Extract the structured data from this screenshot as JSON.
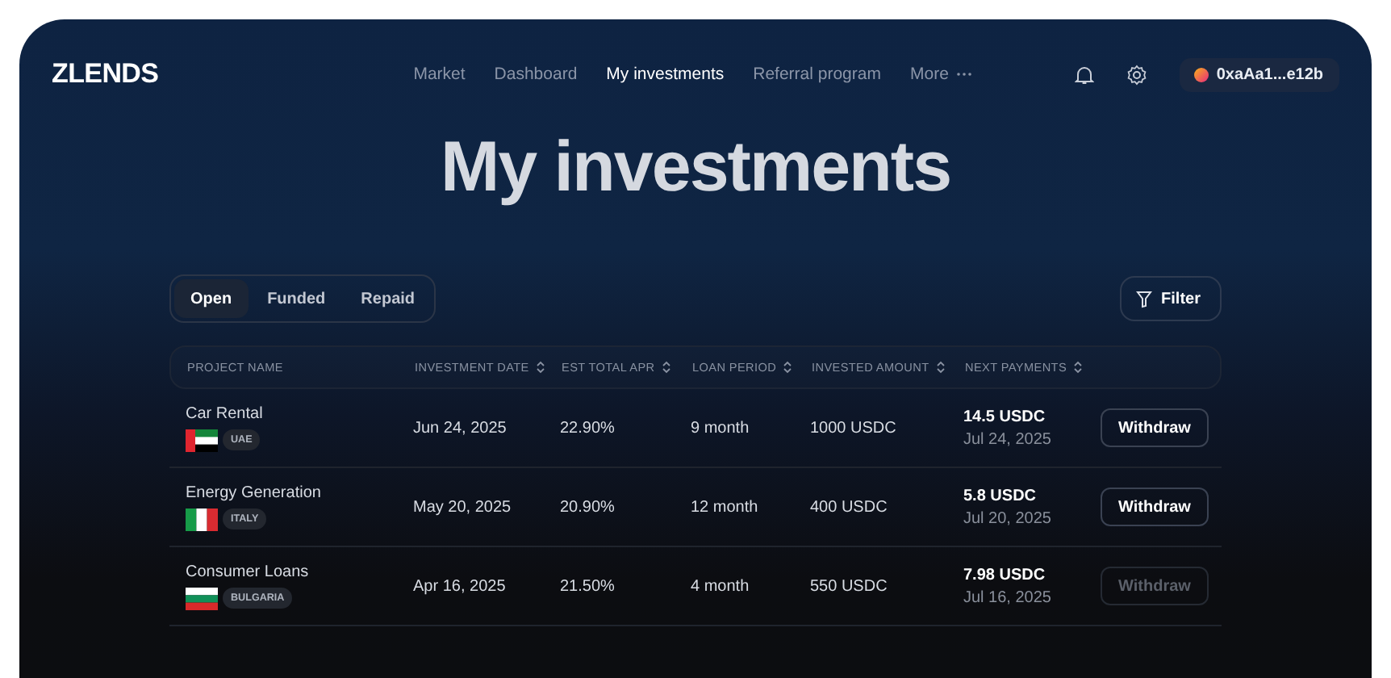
{
  "brand": {
    "logo": "ZLENDS"
  },
  "nav": {
    "links": [
      {
        "label": "Market",
        "selected": false
      },
      {
        "label": "Dashboard",
        "selected": false
      },
      {
        "label": "My investments",
        "selected": true
      },
      {
        "label": "Referral program",
        "selected": false
      },
      {
        "label": "More",
        "selected": false,
        "kind": "more"
      }
    ],
    "wallet": "0xaAa1...e12b"
  },
  "page_title": "My investments",
  "tabs": [
    {
      "label": "Open",
      "selected": true
    },
    {
      "label": "Funded",
      "selected": false
    },
    {
      "label": "Repaid",
      "selected": false
    }
  ],
  "filter_button": "Filter",
  "table": {
    "columns": [
      {
        "label": "PROJECT NAME",
        "sortable": false
      },
      {
        "label": "INVESTMENT DATE",
        "sortable": true
      },
      {
        "label": "EST TOTAL APR",
        "sortable": true
      },
      {
        "label": "LOAN PERIOD",
        "sortable": true
      },
      {
        "label": "INVESTED AMOUNT",
        "sortable": true
      },
      {
        "label": "NEXT PAYMENTS",
        "sortable": true
      }
    ],
    "rows": [
      {
        "project": "Car Rental",
        "kind": "uae",
        "country": "UAE",
        "date": "Jun 24, 2025",
        "apr": "22.90%",
        "period": "9 month",
        "amount": "1000 USDC",
        "next_amount": "14.5 USDC",
        "next_date": "Jul 24, 2025",
        "action": "Withdraw",
        "disabled": false
      },
      {
        "project": "Energy Generation",
        "kind": "italy",
        "country": "ITALY",
        "date": "May 20, 2025",
        "apr": "20.90%",
        "period": "12 month",
        "amount": "400 USDC",
        "next_amount": "5.8 USDC",
        "next_date": "Jul 20, 2025",
        "action": "Withdraw",
        "disabled": false
      },
      {
        "project": "Consumer Loans",
        "kind": "bulgaria",
        "country": "BULGARIA",
        "date": "Apr 16, 2025",
        "apr": "21.50%",
        "period": "4 month",
        "amount": "550 USDC",
        "next_amount": "7.98 USDC",
        "next_date": "Jul 16, 2025",
        "action": "Withdraw",
        "disabled": true
      }
    ]
  }
}
